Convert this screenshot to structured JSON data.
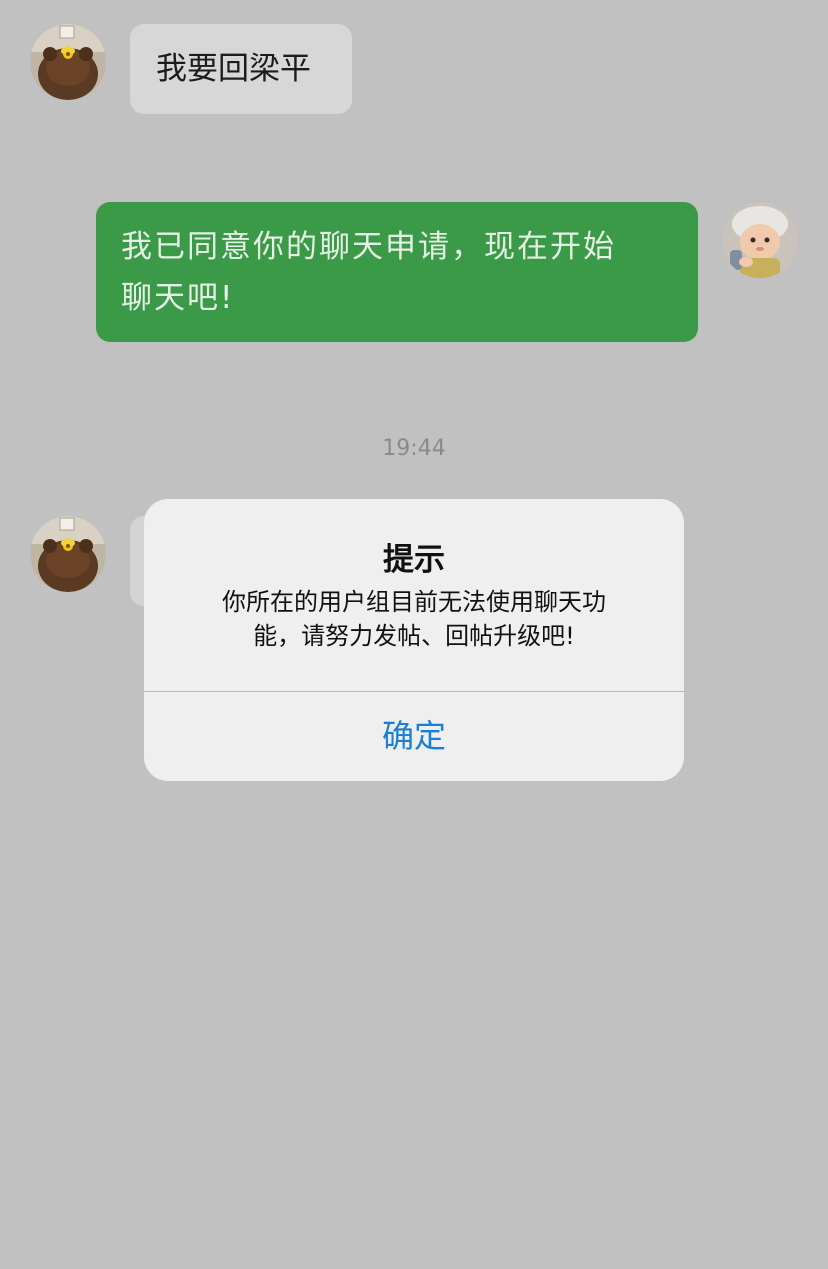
{
  "messages": [
    {
      "direction": "in",
      "text": "我要回梁平"
    },
    {
      "direction": "out",
      "line1": "我已同意你的聊天申请，现在开始",
      "line2": "聊天吧!"
    }
  ],
  "timestamp": "19:44",
  "alert": {
    "title": "提示",
    "message_line1": "你所在的用户组目前无法使用聊天功",
    "message_line2": "能，请努力发帖、回帖升级吧!",
    "confirm_label": "确定"
  },
  "colors": {
    "background": "#c1c1c1",
    "outgoing_bubble": "#3b9a47",
    "incoming_bubble": "#d7d7d7",
    "alert_button": "#1a7fd4"
  },
  "icons": {
    "contact_avatar": "bear-avatar-icon",
    "self_avatar": "baby-avatar-icon"
  }
}
